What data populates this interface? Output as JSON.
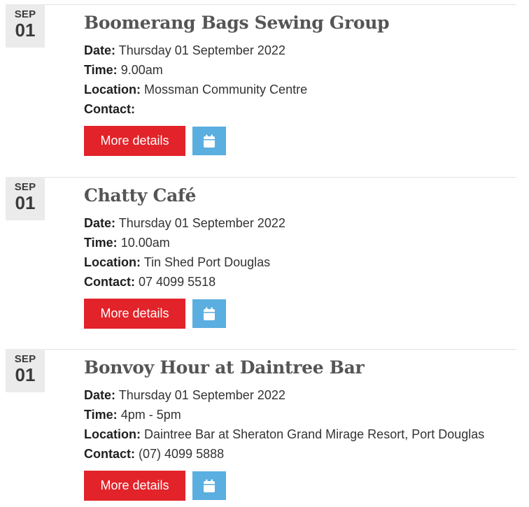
{
  "labels": {
    "date": "Date:",
    "time": "Time:",
    "location": "Location:",
    "contact": "Contact:"
  },
  "events": [
    {
      "month": "SEP",
      "day": "01",
      "title": "Boomerang Bags Sewing Group",
      "date": "Thursday 01 September 2022",
      "time": "9.00am",
      "location": "Mossman Community Centre",
      "contact": "",
      "more_label": "More details",
      "calendar_icon": "calendar-icon"
    },
    {
      "month": "SEP",
      "day": "01",
      "title": "Chatty Café",
      "date": "Thursday 01 September 2022",
      "time": "10.00am",
      "location": "Tin Shed Port Douglas",
      "contact": "07 4099 5518",
      "more_label": "More details",
      "calendar_icon": "calendar-icon"
    },
    {
      "month": "SEP",
      "day": "01",
      "title": "Bonvoy Hour at Daintree Bar",
      "date": "Thursday 01 September 2022",
      "time": "4pm - 5pm",
      "location": "Daintree Bar at Sheraton Grand Mirage Resort, Port Douglas",
      "contact": "(07) 4099 5888",
      "more_label": "More details",
      "calendar_icon": "calendar-icon"
    }
  ],
  "colors": {
    "more_button": "#e2232a",
    "calendar_button": "#5aaee0",
    "badge_background": "#ebebeb",
    "title": "#555555"
  }
}
